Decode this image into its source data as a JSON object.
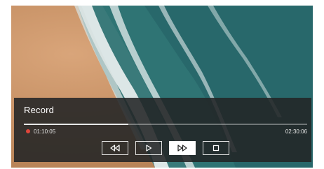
{
  "player": {
    "title": "Record",
    "current_time": "01:10:05",
    "duration": "02:30:06",
    "progress": 0.37,
    "status": "recording",
    "status_color": "#e0463b"
  },
  "controls": [
    {
      "name": "rewind",
      "icon": "rewind-icon",
      "active": false
    },
    {
      "name": "play",
      "icon": "play-icon",
      "active": false
    },
    {
      "name": "fast-forward",
      "icon": "fast-forward-icon",
      "active": true
    },
    {
      "name": "stop",
      "icon": "stop-icon",
      "active": false
    }
  ]
}
